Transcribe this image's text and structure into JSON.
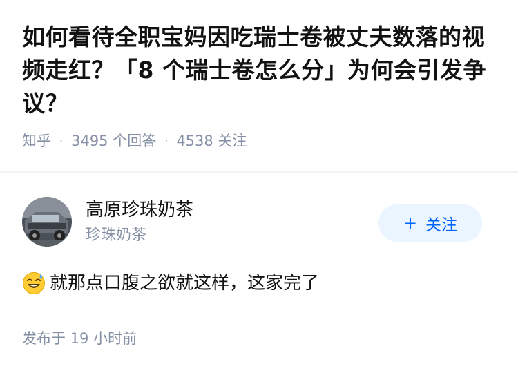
{
  "question": {
    "title": "如何看待全职宝妈因吃瑞士卷被丈夫数落的视频走红？「8 个瑞士卷怎么分」为何会引发争议？",
    "source": "知乎",
    "answers_count": "3495 个回答",
    "followers_count": "4538 关注",
    "separator": "·"
  },
  "answer": {
    "author_name": "高原珍珠奶茶",
    "author_bio": "珍珠奶茶",
    "follow_plus": "+",
    "follow_label": "关注",
    "emoji_icon": "sweat-smile-emoji",
    "content": "就那点口腹之欲就这样，这家完了",
    "time": "发布于 19 小时前"
  },
  "colors": {
    "title": "#121212",
    "meta": "#8590a6",
    "follow_bg": "#ebf5ff",
    "follow_text": "#0066ff"
  }
}
